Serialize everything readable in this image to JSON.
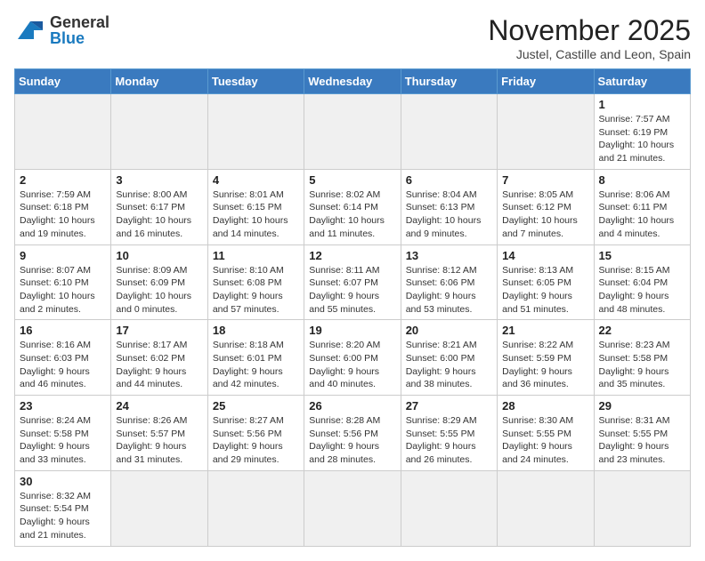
{
  "header": {
    "logo_general": "General",
    "logo_blue": "Blue",
    "month_title": "November 2025",
    "location": "Justel, Castille and Leon, Spain"
  },
  "weekdays": [
    "Sunday",
    "Monday",
    "Tuesday",
    "Wednesday",
    "Thursday",
    "Friday",
    "Saturday"
  ],
  "days": [
    {
      "date": 1,
      "info": "Sunrise: 7:57 AM\nSunset: 6:19 PM\nDaylight: 10 hours\nand 21 minutes."
    },
    {
      "date": 2,
      "info": "Sunrise: 7:59 AM\nSunset: 6:18 PM\nDaylight: 10 hours\nand 19 minutes."
    },
    {
      "date": 3,
      "info": "Sunrise: 8:00 AM\nSunset: 6:17 PM\nDaylight: 10 hours\nand 16 minutes."
    },
    {
      "date": 4,
      "info": "Sunrise: 8:01 AM\nSunset: 6:15 PM\nDaylight: 10 hours\nand 14 minutes."
    },
    {
      "date": 5,
      "info": "Sunrise: 8:02 AM\nSunset: 6:14 PM\nDaylight: 10 hours\nand 11 minutes."
    },
    {
      "date": 6,
      "info": "Sunrise: 8:04 AM\nSunset: 6:13 PM\nDaylight: 10 hours\nand 9 minutes."
    },
    {
      "date": 7,
      "info": "Sunrise: 8:05 AM\nSunset: 6:12 PM\nDaylight: 10 hours\nand 7 minutes."
    },
    {
      "date": 8,
      "info": "Sunrise: 8:06 AM\nSunset: 6:11 PM\nDaylight: 10 hours\nand 4 minutes."
    },
    {
      "date": 9,
      "info": "Sunrise: 8:07 AM\nSunset: 6:10 PM\nDaylight: 10 hours\nand 2 minutes."
    },
    {
      "date": 10,
      "info": "Sunrise: 8:09 AM\nSunset: 6:09 PM\nDaylight: 10 hours\nand 0 minutes."
    },
    {
      "date": 11,
      "info": "Sunrise: 8:10 AM\nSunset: 6:08 PM\nDaylight: 9 hours\nand 57 minutes."
    },
    {
      "date": 12,
      "info": "Sunrise: 8:11 AM\nSunset: 6:07 PM\nDaylight: 9 hours\nand 55 minutes."
    },
    {
      "date": 13,
      "info": "Sunrise: 8:12 AM\nSunset: 6:06 PM\nDaylight: 9 hours\nand 53 minutes."
    },
    {
      "date": 14,
      "info": "Sunrise: 8:13 AM\nSunset: 6:05 PM\nDaylight: 9 hours\nand 51 minutes."
    },
    {
      "date": 15,
      "info": "Sunrise: 8:15 AM\nSunset: 6:04 PM\nDaylight: 9 hours\nand 48 minutes."
    },
    {
      "date": 16,
      "info": "Sunrise: 8:16 AM\nSunset: 6:03 PM\nDaylight: 9 hours\nand 46 minutes."
    },
    {
      "date": 17,
      "info": "Sunrise: 8:17 AM\nSunset: 6:02 PM\nDaylight: 9 hours\nand 44 minutes."
    },
    {
      "date": 18,
      "info": "Sunrise: 8:18 AM\nSunset: 6:01 PM\nDaylight: 9 hours\nand 42 minutes."
    },
    {
      "date": 19,
      "info": "Sunrise: 8:20 AM\nSunset: 6:00 PM\nDaylight: 9 hours\nand 40 minutes."
    },
    {
      "date": 20,
      "info": "Sunrise: 8:21 AM\nSunset: 6:00 PM\nDaylight: 9 hours\nand 38 minutes."
    },
    {
      "date": 21,
      "info": "Sunrise: 8:22 AM\nSunset: 5:59 PM\nDaylight: 9 hours\nand 36 minutes."
    },
    {
      "date": 22,
      "info": "Sunrise: 8:23 AM\nSunset: 5:58 PM\nDaylight: 9 hours\nand 35 minutes."
    },
    {
      "date": 23,
      "info": "Sunrise: 8:24 AM\nSunset: 5:58 PM\nDaylight: 9 hours\nand 33 minutes."
    },
    {
      "date": 24,
      "info": "Sunrise: 8:26 AM\nSunset: 5:57 PM\nDaylight: 9 hours\nand 31 minutes."
    },
    {
      "date": 25,
      "info": "Sunrise: 8:27 AM\nSunset: 5:56 PM\nDaylight: 9 hours\nand 29 minutes."
    },
    {
      "date": 26,
      "info": "Sunrise: 8:28 AM\nSunset: 5:56 PM\nDaylight: 9 hours\nand 28 minutes."
    },
    {
      "date": 27,
      "info": "Sunrise: 8:29 AM\nSunset: 5:55 PM\nDaylight: 9 hours\nand 26 minutes."
    },
    {
      "date": 28,
      "info": "Sunrise: 8:30 AM\nSunset: 5:55 PM\nDaylight: 9 hours\nand 24 minutes."
    },
    {
      "date": 29,
      "info": "Sunrise: 8:31 AM\nSunset: 5:55 PM\nDaylight: 9 hours\nand 23 minutes."
    },
    {
      "date": 30,
      "info": "Sunrise: 8:32 AM\nSunset: 5:54 PM\nDaylight: 9 hours\nand 21 minutes."
    }
  ]
}
